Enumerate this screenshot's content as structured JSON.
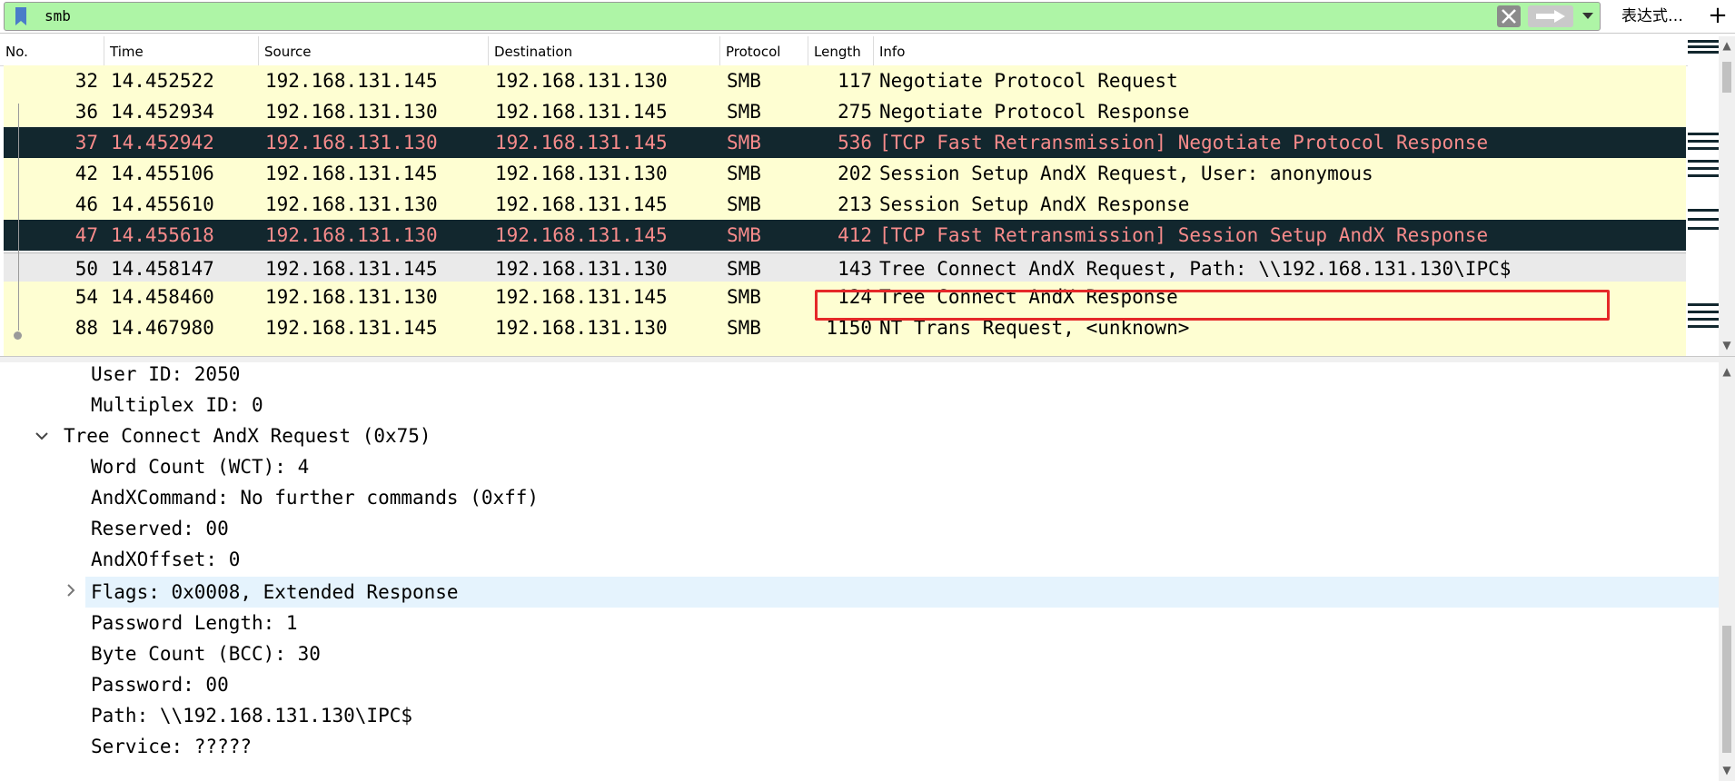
{
  "filter": {
    "value": "smb",
    "expression_label": "表达式…",
    "add_label": "+"
  },
  "columns": [
    "No.",
    "Time",
    "Source",
    "Destination",
    "Protocol",
    "Length",
    "Info"
  ],
  "packets": [
    {
      "no": "32",
      "time": "14.452522",
      "src": "192.168.131.145",
      "dst": "192.168.131.130",
      "proto": "SMB",
      "len": "117",
      "info": "Negotiate Protocol Request"
    },
    {
      "no": "36",
      "time": "14.452934",
      "src": "192.168.131.130",
      "dst": "192.168.131.145",
      "proto": "SMB",
      "len": "275",
      "info": "Negotiate Protocol Response"
    },
    {
      "no": "37",
      "time": "14.452942",
      "src": "192.168.131.130",
      "dst": "192.168.131.145",
      "proto": "SMB",
      "len": "536",
      "info": "[TCP Fast Retransmission] Negotiate Protocol Response"
    },
    {
      "no": "42",
      "time": "14.455106",
      "src": "192.168.131.145",
      "dst": "192.168.131.130",
      "proto": "SMB",
      "len": "202",
      "info": "Session Setup AndX Request, User: anonymous"
    },
    {
      "no": "46",
      "time": "14.455610",
      "src": "192.168.131.130",
      "dst": "192.168.131.145",
      "proto": "SMB",
      "len": "213",
      "info": "Session Setup AndX Response"
    },
    {
      "no": "47",
      "time": "14.455618",
      "src": "192.168.131.130",
      "dst": "192.168.131.145",
      "proto": "SMB",
      "len": "412",
      "info": "[TCP Fast Retransmission] Session Setup AndX Response"
    },
    {
      "no": "50",
      "time": "14.458147",
      "src": "192.168.131.145",
      "dst": "192.168.131.130",
      "proto": "SMB",
      "len": "143",
      "info": "Tree Connect AndX Request, Path: \\\\192.168.131.130\\IPC$"
    },
    {
      "no": "54",
      "time": "14.458460",
      "src": "192.168.131.130",
      "dst": "192.168.131.145",
      "proto": "SMB",
      "len": "124",
      "info": "Tree Connect AndX Response"
    },
    {
      "no": "88",
      "time": "14.467980",
      "src": "192.168.131.145",
      "dst": "192.168.131.130",
      "proto": "SMB",
      "len": "1150",
      "info": "NT Trans Request, <unknown>"
    }
  ],
  "details": {
    "user_id": "User ID: 2050",
    "multiplex_id": "Multiplex ID: 0",
    "tree_connect": "Tree Connect AndX Request (0x75)",
    "word_count": "Word Count (WCT): 4",
    "andx_command": "AndXCommand: No further commands (0xff)",
    "reserved": "Reserved: 00",
    "andx_offset": "AndXOffset: 0",
    "flags": "Flags: 0x0008, Extended Response",
    "password_length": "Password Length: 1",
    "byte_count": "Byte Count (BCC): 30",
    "password": "Password: 00",
    "path": "Path: \\\\192.168.131.130\\IPC$",
    "service": "Service: ?????"
  },
  "colors": {
    "filter_bg": "#aef5a6",
    "row_normal": "#fefed2",
    "row_retrans_bg": "#12272e",
    "row_retrans_fg": "#f78b8b",
    "highlight": "#e52929"
  }
}
